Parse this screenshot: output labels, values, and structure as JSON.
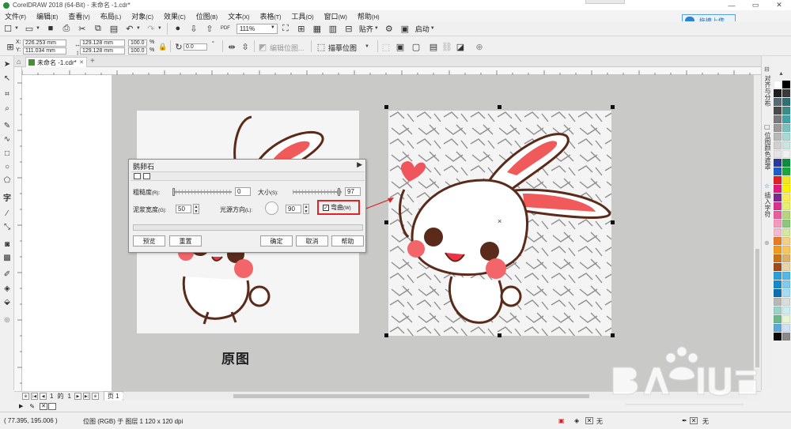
{
  "window": {
    "title": "CorelDRAW 2018 (64-Bit) - 未命名 -1.cdr*",
    "minimize": "—",
    "restore": "▭",
    "close": "✕"
  },
  "menu": [
    {
      "label": "文件",
      "key": "(F)"
    },
    {
      "label": "编辑",
      "key": "(E)"
    },
    {
      "label": "查看",
      "key": "(V)"
    },
    {
      "label": "布局",
      "key": "(L)"
    },
    {
      "label": "对象",
      "key": "(C)"
    },
    {
      "label": "效果",
      "key": "(C)"
    },
    {
      "label": "位图",
      "key": "(B)"
    },
    {
      "label": "文本",
      "key": "(X)"
    },
    {
      "label": "表格",
      "key": "(T)"
    },
    {
      "label": "工具",
      "key": "(O)"
    },
    {
      "label": "窗口",
      "key": "(W)"
    },
    {
      "label": "帮助",
      "key": "(H)"
    }
  ],
  "upload_button": "拖拽上传",
  "toolbar1": {
    "pdf_label": "PDF",
    "zoom": "111%",
    "snap_label": "贴齐",
    "launch_label": "启动"
  },
  "property_bar": {
    "x_label": "X:",
    "x_value": "226.253 mm",
    "y_label": "Y:",
    "y_value": "111.034 mm",
    "w_value": "129.128 mm",
    "h_value": "129.128 mm",
    "scale_w": "100.0",
    "scale_h": "100.0",
    "pct": "%",
    "rotation": "0.0",
    "degree": "°",
    "edit_bitmap": "编辑位图...",
    "trace_bitmap": "描摹位图"
  },
  "tab": {
    "name": "未命名 -1.cdr*"
  },
  "canvas": {
    "caption": "原图"
  },
  "dialog": {
    "title": "鹅卵石",
    "roughness_label": "粗糙度",
    "roughness_key": "(R):",
    "roughness_value": "0",
    "size_label": "大小",
    "size_key": "(S):",
    "size_value": "97",
    "mortar_label": "泥浆宽度",
    "mortar_key": "(G):",
    "mortar_value": "50",
    "light_label": "光源方向",
    "light_key": "(L):",
    "light_value": "90",
    "warp_label": "弯曲",
    "warp_key": "(W)",
    "warp_checked": true,
    "preview_btn": "预览",
    "reset_btn": "重置",
    "ok_btn": "确定",
    "cancel_btn": "取消",
    "help_btn": "帮助"
  },
  "dockers": [
    {
      "label": "对齐与分布",
      "icon": "align-icon"
    },
    {
      "label": "位图颜色遮罩",
      "icon": "mask-icon"
    },
    {
      "label": "插入字符",
      "icon": "star-icon"
    }
  ],
  "pagenav": {
    "current": "1",
    "of": "的",
    "total": "1",
    "page_tab": "页 1"
  },
  "status": {
    "coords": "( 77.395, 195.006 )",
    "object_info": "位图 (RGB) 于 图层 1 120 x 120 dpi",
    "fill_none": "无",
    "outline_none": "无"
  },
  "colors": {
    "accent_red": "#e02424",
    "canvas_gray": "#c9cac8",
    "upload_blue": "#2b83d4"
  },
  "palette_colors": [
    "#ffffff",
    "#000000",
    "#1f1f1f",
    "#3a3a3a",
    "#5a6a73",
    "#2e6f78",
    "#4a4a4a",
    "#3c8c8c",
    "#7a7a7a",
    "#3fa3a8",
    "#9a9a9a",
    "#7ac2c2",
    "#b8b8b8",
    "#a7d8d2",
    "#d0d0d0",
    "#c8e6df",
    "#e4e4e4",
    "#f0f0f0",
    "#2a3a9a",
    "#0b8f3a",
    "#1f5fc4",
    "#17a93c",
    "#e01f26",
    "#f3e61b",
    "#e0197b",
    "#fff000",
    "#7c2a8a",
    "#f9ec5b",
    "#d7348f",
    "#e6f06a",
    "#ea5f9a",
    "#b7d57a",
    "#f29bbd",
    "#8cc87a",
    "#f5b9cf",
    "#d5e8a2",
    "#ea7a24",
    "#f3d08a",
    "#f39a1d",
    "#f7c65e",
    "#c9731c",
    "#dcb16a",
    "#a04a1a",
    "#e9d3a8",
    "#2c9ed9",
    "#54b9e8",
    "#1789c9",
    "#7dcbef",
    "#0f6fae",
    "#a5dbf3",
    "#b8b8b8",
    "#dcdcdc",
    "#9ad3c8",
    "#c8ecef",
    "#6fb88c",
    "#e8f4d4",
    "#5fa7d8",
    "#cfe2f5",
    "#0a0a0a",
    "#8a8a8a"
  ]
}
